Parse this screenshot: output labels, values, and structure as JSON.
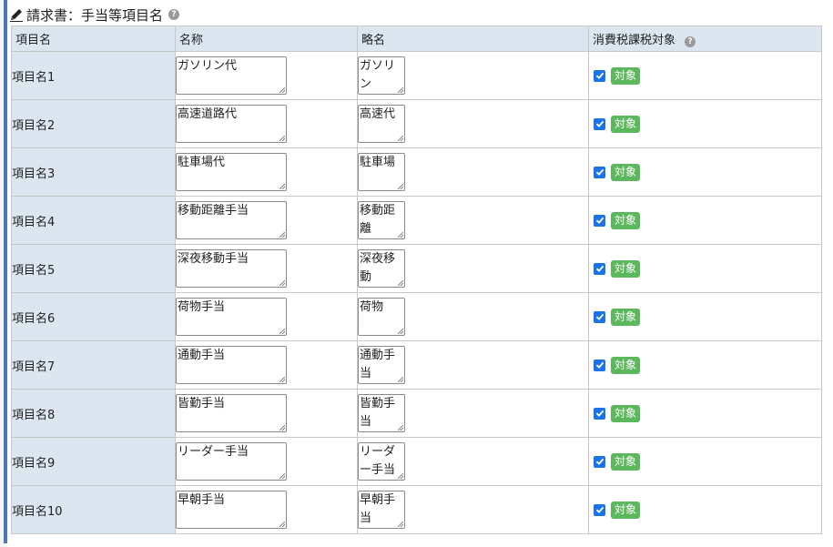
{
  "header": {
    "title": "請求書：手当等項目名",
    "help": "?"
  },
  "columns": {
    "item": "項目名",
    "name": "名称",
    "abbr": "略名",
    "tax": "消費税課税対象",
    "tax_help": "?"
  },
  "rows": [
    {
      "label": "項目名1",
      "name": "ガソリン代",
      "abbr": "ガソリン",
      "tax_checked": true,
      "badge": "対象"
    },
    {
      "label": "項目名2",
      "name": "高速道路代",
      "abbr": "高速代",
      "tax_checked": true,
      "badge": "対象"
    },
    {
      "label": "項目名3",
      "name": "駐車場代",
      "abbr": "駐車場",
      "tax_checked": true,
      "badge": "対象"
    },
    {
      "label": "項目名4",
      "name": "移動距離手当",
      "abbr": "移動距離",
      "tax_checked": true,
      "badge": "対象"
    },
    {
      "label": "項目名5",
      "name": "深夜移動手当",
      "abbr": "深夜移動",
      "tax_checked": true,
      "badge": "対象"
    },
    {
      "label": "項目名6",
      "name": "荷物手当",
      "abbr": "荷物",
      "tax_checked": true,
      "badge": "対象"
    },
    {
      "label": "項目名7",
      "name": "通動手当",
      "abbr": "通動手当",
      "tax_checked": true,
      "badge": "対象"
    },
    {
      "label": "項目名8",
      "name": "皆勤手当",
      "abbr": "皆勤手当",
      "tax_checked": true,
      "badge": "対象"
    },
    {
      "label": "項目名9",
      "name": "リーダー手当",
      "abbr": "リーダー手当",
      "tax_checked": true,
      "badge": "対象"
    },
    {
      "label": "項目名10",
      "name": "早朝手当",
      "abbr": "早朝手当",
      "tax_checked": true,
      "badge": "対象"
    }
  ],
  "colors": {
    "header_bg": "#dce6f1",
    "accent_bar": "#4a78b8",
    "checkbox": "#1a73e8",
    "badge": "#5cb85c"
  }
}
